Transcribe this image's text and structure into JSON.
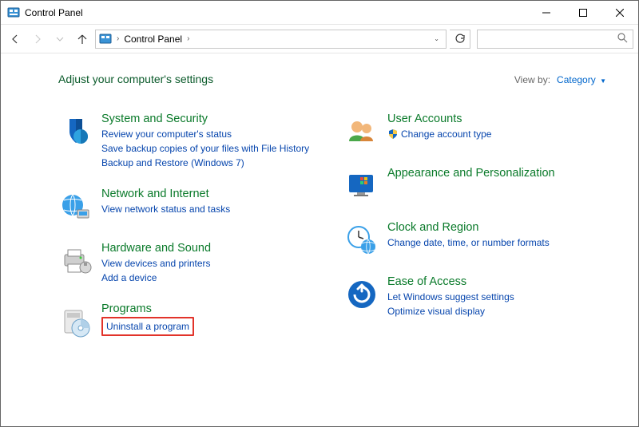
{
  "titlebar": {
    "title": "Control Panel"
  },
  "address": {
    "location": "Control Panel"
  },
  "search": {
    "placeholder": ""
  },
  "main": {
    "heading": "Adjust your computer's settings",
    "viewby_label": "View by:",
    "viewby_value": "Category"
  },
  "left": {
    "system": {
      "title": "System and Security",
      "l1": "Review your computer's status",
      "l2": "Save backup copies of your files with File History",
      "l3": "Backup and Restore (Windows 7)"
    },
    "network": {
      "title": "Network and Internet",
      "l1": "View network status and tasks"
    },
    "hardware": {
      "title": "Hardware and Sound",
      "l1": "View devices and printers",
      "l2": "Add a device"
    },
    "programs": {
      "title": "Programs",
      "l1": "Uninstall a program"
    }
  },
  "right": {
    "users": {
      "title": "User Accounts",
      "l1": "Change account type"
    },
    "appearance": {
      "title": "Appearance and Personalization"
    },
    "clock": {
      "title": "Clock and Region",
      "l1": "Change date, time, or number formats"
    },
    "ease": {
      "title": "Ease of Access",
      "l1": "Let Windows suggest settings",
      "l2": "Optimize visual display"
    }
  }
}
